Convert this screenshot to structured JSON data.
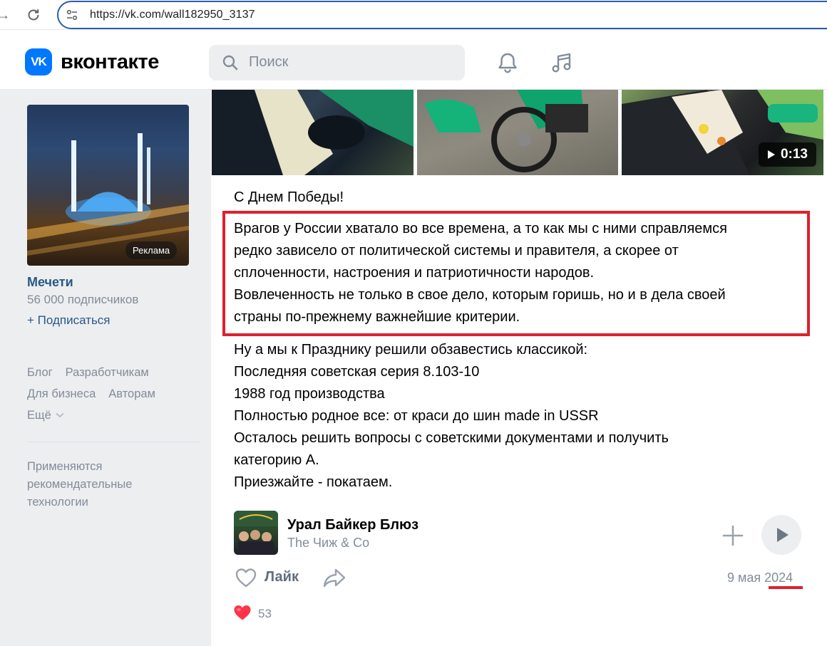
{
  "browser": {
    "url": "https://vk.com/wall182950_3137"
  },
  "header": {
    "logo_text": "VK",
    "wordmark": "вконтакте",
    "search_placeholder": "Поиск"
  },
  "sidebar": {
    "ad_badge": "Реклама",
    "group_name": "Мечети",
    "group_subscribers": "56 000 подписчиков",
    "subscribe_label": "+ Подписаться",
    "footer_links": [
      "Блог",
      "Разработчикам",
      "Для бизнеса",
      "Авторам",
      "Ещё"
    ],
    "recommend_text": "Применяются рекомендательные технологии"
  },
  "post": {
    "video_duration": "0:13",
    "greeting": "С Днем Победы!",
    "highlight_lines": [
      "Врагов у России хватало во все времена, а то как мы с ними справляемся",
      "редко зависело от политической системы и правителя, а скорее от",
      "сплоченности, настроения и патриотичности народов.",
      "Вовлеченность не только в свое дело, которым горишь, но и в дела своей",
      "страны по-прежнему важнейшие критерии."
    ],
    "body_lines": [
      "Ну а мы к Празднику решили обзавестись классикой:",
      "Последняя советская серия 8.103-10",
      "1988 год производства",
      "Полностью родное все: от краси до шин made in USSR",
      "Осталось решить вопросы с советскими документами и получить",
      "категорию А.",
      "Приезжайте - покатаем."
    ],
    "audio": {
      "title": "Урал Байкер Блюз",
      "artist": "The Чиж & Co"
    },
    "like_label": "Лайк",
    "date": "9 мая 2024",
    "reaction_count": "53"
  },
  "colors": {
    "vk_blue": "#0077ff",
    "link": "#2a5885",
    "muted": "#818c99",
    "highlight_red": "#e0202c"
  }
}
